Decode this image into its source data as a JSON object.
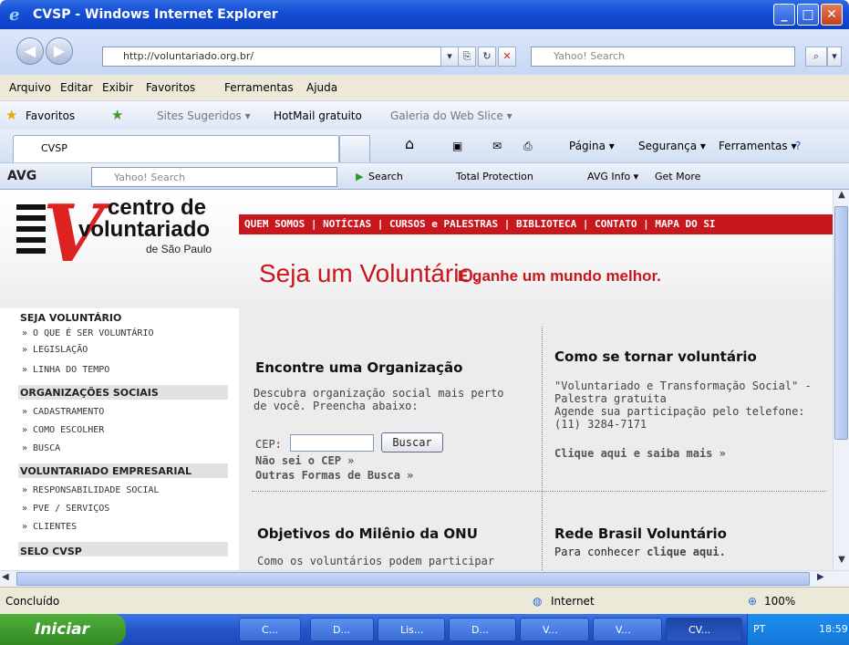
{
  "window": {
    "title": "CVSP - Windows Internet Explorer"
  },
  "address": {
    "url": "http://voluntariado.org.br/",
    "search_placeholder": "Yahoo! Search"
  },
  "menu": [
    "Arquivo",
    "Editar",
    "Exibir",
    "Favoritos",
    "Ferramentas",
    "Ajuda"
  ],
  "favorites": {
    "label": "Favoritos",
    "items": [
      "Sites Sugeridos ▾",
      "HotMail gratuito",
      "Galeria do Web Slice ▾"
    ]
  },
  "tabs": {
    "current": "CVSP",
    "commands": [
      "Página ▾",
      "Segurança ▾",
      "Ferramentas ▾"
    ]
  },
  "avg": {
    "brand": "AVG",
    "search_placeholder": "Yahoo! Search",
    "search_btn": "Search",
    "protection": "Total Protection",
    "info": "AVG Info ▾",
    "more": "Get More"
  },
  "site": {
    "logo": {
      "line1": "centro de",
      "line2": "voluntariado",
      "line3": "de São Paulo"
    },
    "topnav": "QUEM SOMOS | NOTÍCIAS | CURSOS e PALESTRAS | BIBLIOTECA | CONTATO | MAPA DO SI",
    "slogan_main": "Seja um Voluntário.",
    "slogan_sub": "E ganhe um mundo melhor.",
    "leftnav": {
      "s1": {
        "title": "SEJA VOLUNTÁRIO",
        "items": [
          "» O QUE É SER VOLUNTÁRIO",
          "» LEGISLAÇÃO",
          "» LINHA DO TEMPO"
        ]
      },
      "s2": {
        "title": "ORGANIZAÇÕES SOCIAIS",
        "items": [
          "» CADASTRAMENTO",
          "» COMO ESCOLHER",
          "» BUSCA"
        ]
      },
      "s3": {
        "title": "VOLUNTARIADO EMPRESARIAL",
        "items": [
          "» RESPONSABILIDADE SOCIAL",
          "» PVE / SERVIÇOS",
          "» CLIENTES"
        ]
      },
      "s4": {
        "title": "SELO CVSP"
      }
    },
    "find": {
      "title": "Encontre uma Organização",
      "desc1": "Descubra organização social mais perto",
      "desc2": "de você. Preencha abaixo:",
      "cep_label": "CEP:",
      "button": "Buscar",
      "link1": "Não sei o CEP »",
      "link2": "Outras Formas de Busca »"
    },
    "become": {
      "title": "Como se tornar voluntário",
      "l1": "\"Voluntariado e Transformação Social\" -",
      "l2": "Palestra gratuita",
      "l3": "Agende sua participação pelo telefone:",
      "l4": "(11) 3284-7171",
      "link": "Clique aqui e saiba mais »"
    },
    "onu": {
      "title": "Objetivos do Milênio da ONU",
      "text": "Como os voluntários podem participar"
    },
    "rede": {
      "title": "Rede Brasil Voluntário",
      "text": "Para conhecer ",
      "link": "clique aqui."
    }
  },
  "status": {
    "text": "Concluído",
    "zone": "Internet",
    "zoom": "100%"
  },
  "taskbar": {
    "start": "Iniciar",
    "items": [
      "C...",
      "D...",
      "Lis...",
      "D...",
      "V...",
      "V...",
      "CV..."
    ],
    "lang": "PT",
    "time": "18:59"
  }
}
